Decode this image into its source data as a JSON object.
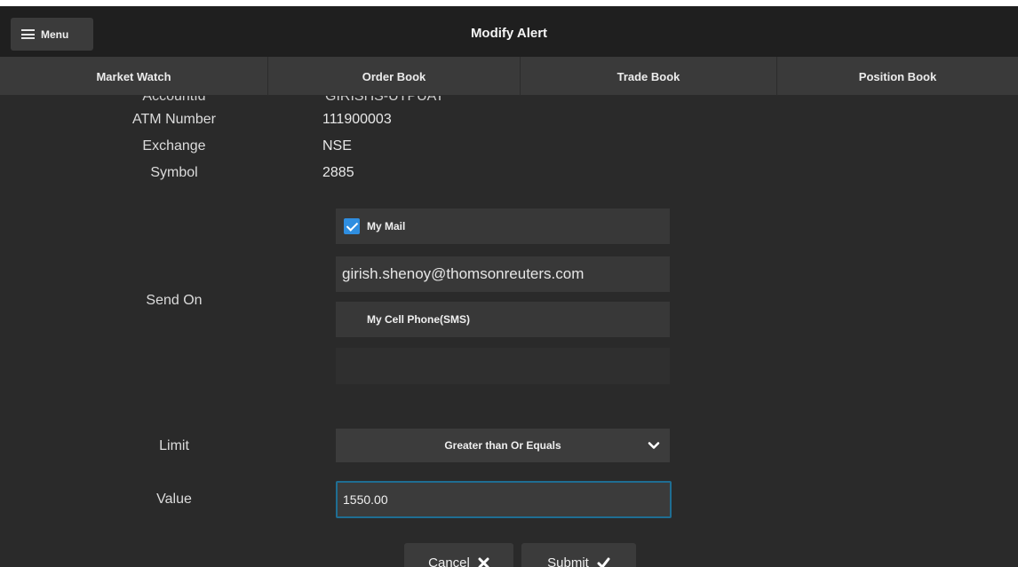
{
  "header": {
    "menu_label": "Menu",
    "title": "Modify Alert"
  },
  "tabs": [
    {
      "label": "Market Watch"
    },
    {
      "label": "Order Book"
    },
    {
      "label": "Trade Book"
    },
    {
      "label": "Position Book"
    }
  ],
  "details": {
    "clipped_label": "AccountId",
    "clipped_value": "GIRISHS-UTPUAT",
    "rows": [
      {
        "label": "ATM Number",
        "value": "111900003"
      },
      {
        "label": "Exchange",
        "value": "NSE"
      },
      {
        "label": "Symbol",
        "value": "2885"
      }
    ]
  },
  "send_on": {
    "label": "Send On",
    "my_mail": {
      "label": "My Mail",
      "checked": true
    },
    "email": "girish.shenoy@thomsonreuters.com",
    "my_cell": {
      "label": "My Cell Phone(SMS)",
      "checked": false
    }
  },
  "limit": {
    "label": "Limit",
    "selected": "Greater than Or Equals"
  },
  "value_field": {
    "label": "Value",
    "value": "1550.00"
  },
  "actions": {
    "cancel_label": "Cancel",
    "submit_label": "Submit"
  },
  "colors": {
    "accent": "#2f8ee0",
    "focus_border": "#1f6e93",
    "background": "#2a2a2a"
  }
}
